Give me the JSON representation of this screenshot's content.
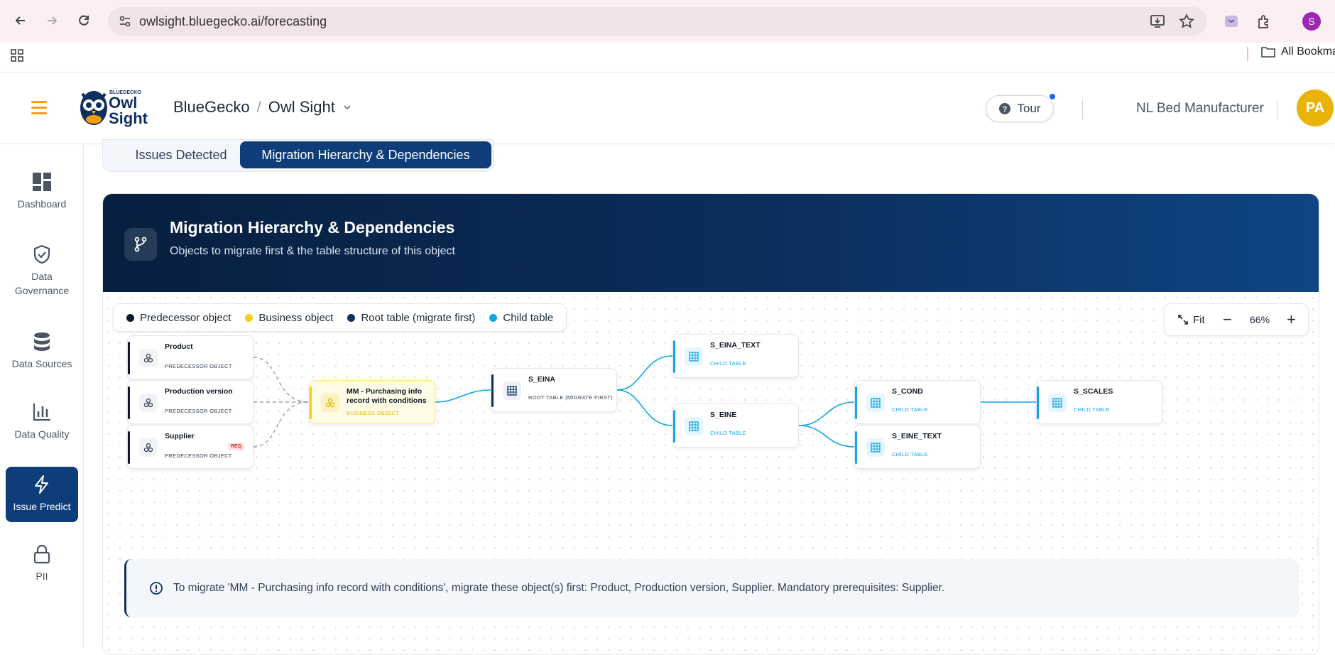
{
  "browser": {
    "url": "owlsight.bluegecko.ai/forecasting",
    "bookmarks_label": "All Bookma",
    "profile_initial": "S"
  },
  "header": {
    "logo_top": "BLUEGECKO",
    "logo_word1": "Owl",
    "logo_word2": "Sight",
    "breadcrumb_org": "BlueGecko",
    "breadcrumb_sep": "/",
    "breadcrumb_app": "Owl Sight",
    "tour_label": "Tour",
    "company": "NL Bed Manufacturer",
    "avatar_initials": "PA"
  },
  "sidebar": {
    "items": [
      {
        "label": "Dashboard",
        "icon": "dashboard-icon"
      },
      {
        "label": "Data Governance",
        "icon": "shield-check-icon"
      },
      {
        "label": "Data Sources",
        "icon": "database-icon"
      },
      {
        "label": "Data Quality",
        "icon": "bar-chart-icon"
      },
      {
        "label": "Issue Predict",
        "icon": "lightning-icon",
        "active": true
      },
      {
        "label": "PII",
        "icon": "lock-icon"
      }
    ]
  },
  "tabs": [
    {
      "label": "Issues Detected",
      "active": false
    },
    {
      "label": "Migration Hierarchy & Dependencies",
      "active": true
    }
  ],
  "banner": {
    "title": "Migration Hierarchy & Dependencies",
    "subtitle": "Objects to migrate first & the table structure of this object"
  },
  "legend": [
    {
      "label": "Predecessor object",
      "color": "#0f172a"
    },
    {
      "label": "Business object",
      "color": "#facc15"
    },
    {
      "label": "Root table (migrate first)",
      "color": "#0f2f5f"
    },
    {
      "label": "Child table",
      "color": "#0ea5e9"
    }
  ],
  "zoom": {
    "fit_label": "Fit",
    "level": "66%"
  },
  "nodes": {
    "product": {
      "name": "Product",
      "type": "PREDECESSOR OBJECT"
    },
    "production_version": {
      "name": "Production version",
      "type": "PREDECESSOR OBJECT"
    },
    "supplier": {
      "name": "Supplier",
      "type": "PREDECESSOR OBJECT",
      "badge": "REQ"
    },
    "business": {
      "name": "MM - Purchasing info record with conditions",
      "type": "BUSINESS OBJECT"
    },
    "s_eina": {
      "name": "S_EINA",
      "type": "ROOT TABLE (MIGRATE FIRST)"
    },
    "s_eina_text": {
      "name": "S_EINA_TEXT",
      "type": "CHILD TABLE"
    },
    "s_eine": {
      "name": "S_EINE",
      "type": "CHILD TABLE"
    },
    "s_cond": {
      "name": "S_COND",
      "type": "CHILD TABLE"
    },
    "s_eine_text": {
      "name": "S_EINE_TEXT",
      "type": "CHILD TABLE"
    },
    "s_scales": {
      "name": "S_SCALES",
      "type": "CHILD TABLE"
    }
  },
  "alert": {
    "text": "To migrate 'MM - Purchasing info record with conditions', migrate these object(s) first: Product, Production version, Supplier. Mandatory prerequisites: Supplier."
  },
  "colors": {
    "brand_navy": "#0f3d7a",
    "accent_orange": "#f59e0b",
    "child_blue": "#0ea5e9"
  }
}
